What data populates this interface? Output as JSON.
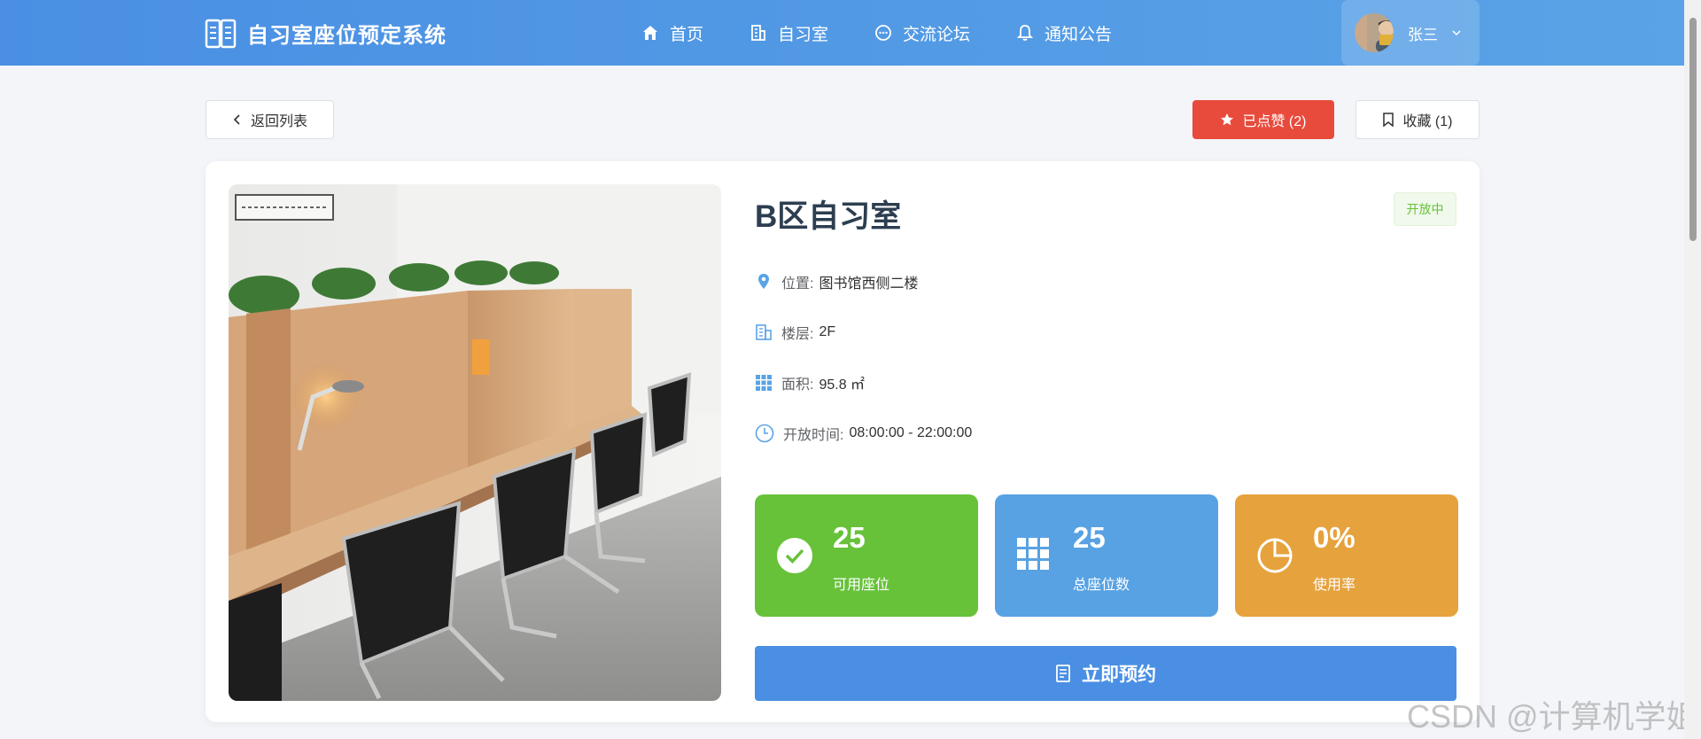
{
  "navbar": {
    "title": "自习室座位预定系统",
    "menu": [
      {
        "label": "首页",
        "icon": "home-icon"
      },
      {
        "label": "自习室",
        "icon": "building-icon"
      },
      {
        "label": "交流论坛",
        "icon": "chat-icon"
      },
      {
        "label": "通知公告",
        "icon": "bell-icon"
      }
    ],
    "user": {
      "name": "张三"
    }
  },
  "actions": {
    "back_label": "返回列表",
    "liked_label": "已点赞 (2)",
    "favorite_label": "收藏 (1)"
  },
  "room": {
    "name": "B区自习室",
    "status": "开放中",
    "location_label": "位置:",
    "location": "图书馆西侧二楼",
    "floor_label": "楼层:",
    "floor": "2F",
    "area_label": "面积:",
    "area": "95.8 ㎡",
    "hours_label": "开放时间:",
    "hours": "08:00:00 - 22:00:00"
  },
  "stats": [
    {
      "value": "25",
      "label": "可用座位",
      "color": "#67c23a",
      "icon": "check-circle-icon"
    },
    {
      "value": "25",
      "label": "总座位数",
      "color": "#58a2e3",
      "icon": "grid-icon"
    },
    {
      "value": "0%",
      "label": "使用率",
      "color": "#e6a23c",
      "icon": "pie-chart-icon"
    }
  ],
  "reserve_label": "立即预约",
  "watermark": "CSDN @计算机学姐",
  "colors": {
    "primary": "#4a8fe3",
    "danger": "#e84b3c",
    "success": "#67c23a",
    "warning": "#e6a23c"
  }
}
